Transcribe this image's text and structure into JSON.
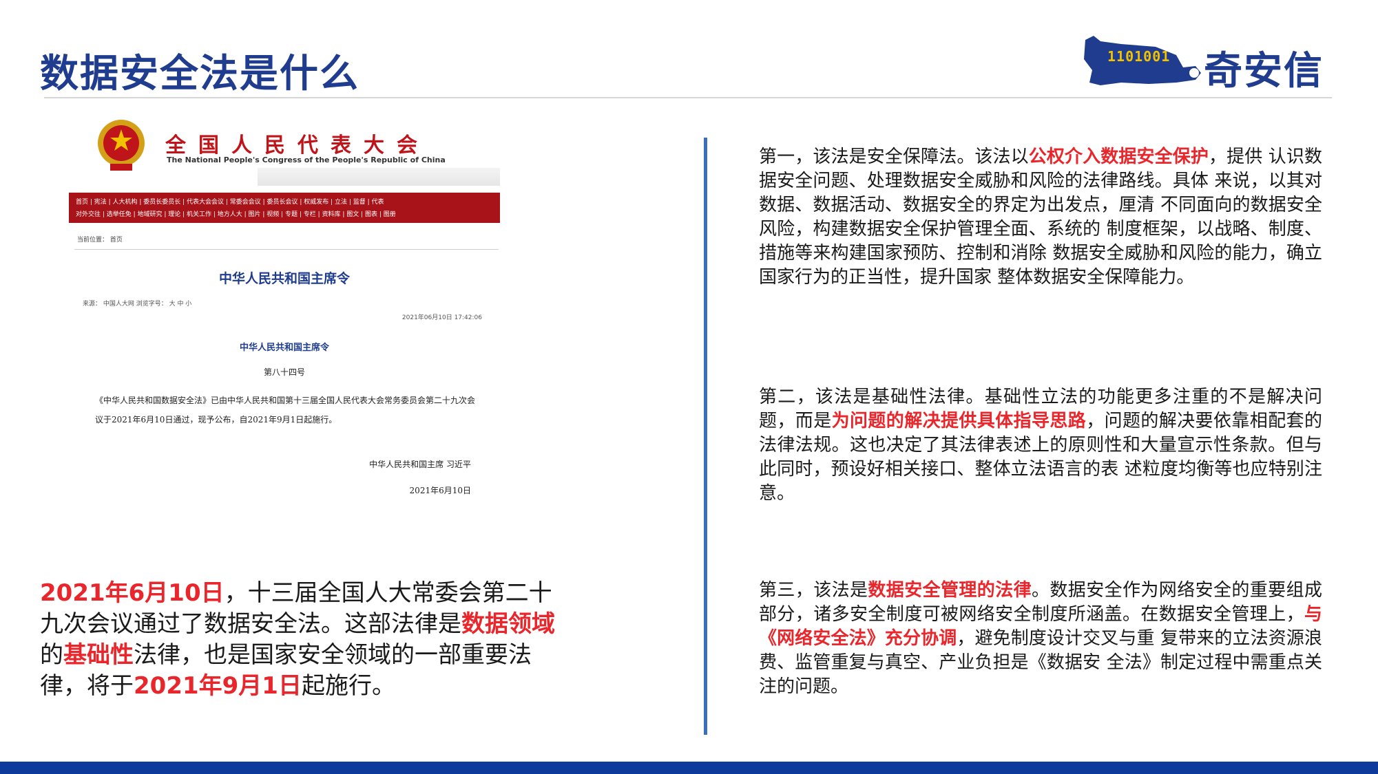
{
  "header": {
    "title": "数据安全法是什么",
    "logo_text": "奇安信",
    "logo_digits": "1101001"
  },
  "document_screenshot": {
    "org_name_cn": "全国人民代表大会",
    "org_name_en": "The National People's Congress of the People's Republic of China",
    "nav_row_1": "首页 | 宪法 | 人大机构 | 委员长委员长 | 代表大会会议 | 常委会会议 | 委员长会议 | 权威发布 | 立法 | 监督 | 代表",
    "nav_row_2": "对外交往 | 选举任免 | 地域研究 | 理论 | 机关工作 | 地方人大 | 图片 | 视频 | 专题 | 专栏 | 资料库 | 图文 | 图表 | 图册",
    "location": "当前位置：  首页",
    "headline": "中华人民共和国主席令",
    "meta": "来源：  中国人大网    浏览字号：  大  中  小",
    "timestamp": "2021年06月10日  17:42:06",
    "subheadline": "中华人民共和国主席令",
    "order_number": "第八十四号",
    "body": "《中华人民共和国数据安全法》已由中华人民共和国第十三届全国人民代表大会常务委员会第二十九次会议于2021年6月10日通过，现予公布，自2021年9月1日起施行。",
    "signature": "中华人民共和国主席    习近平",
    "sign_date": "2021年6月10日"
  },
  "left_summary": {
    "date_passed": "2021年6月10日",
    "text_1": "，十三届全国人大常委会第二十九次会议通过了数据安全法。这部法律是",
    "highlight_1": "数据领域",
    "text_2": "的",
    "highlight_2": "基础性",
    "text_3": "法律，也是国家安全领域的一部重要法律，将于",
    "date_effective": "2021年9月1日",
    "text_4": "起施行。"
  },
  "right_points": [
    {
      "pre": "第一，该法是安全保障法。该法以",
      "highlight": "公权介入数据安全保护",
      "post": "，提供  认识数据安全问题、处理数据安全威胁和风险的法律路线。具体   来说，以其对数据、数据活动、数据安全的界定为出发点，厘清   不同面向的数据安全风险，构建数据安全保护管理全面、系统的   制度框架，以战略、制度、措施等来构建国家预防、控制和消除   数据安全威胁和风险的能力，确立国家行为的正当性，提升国家   整体数据安全保障能力。"
    },
    {
      "pre": "第二，该法是基础性法律。基础性立法的功能更多注重的不是解决问题，而是",
      "highlight": "为问题的解决提供具体指导思路",
      "post": "，问题的解决要依靠相配套的法律法规。这也决定了其法律表述上的原则性和大量宣示性条款。但与此同时，预设好相关接口、整体立法语言的表  述粒度均衡等也应特别注意。"
    },
    {
      "pre": "第三，该法是",
      "highlight": "数据安全管理的法律",
      "mid": "。数据安全作为网络安全的重要组成部分，诸多安全制度可被网络安全制度所涵盖。在数据安全管理上，",
      "highlight_2": "与《网络安全法》充分协调",
      "post": "，避免制度设计交叉与重  复带来的立法资源浪费、监管重复与真空、产业负担是《数据安   全法》制定过程中需重点关注的问题。"
    }
  ],
  "colors": {
    "title_blue": "#1f3c8f",
    "highlight_red": "#e8262b",
    "divider_blue": "#3a6fbf",
    "footer_blue": "#0e3a9c",
    "npc_red": "#c0141b"
  }
}
